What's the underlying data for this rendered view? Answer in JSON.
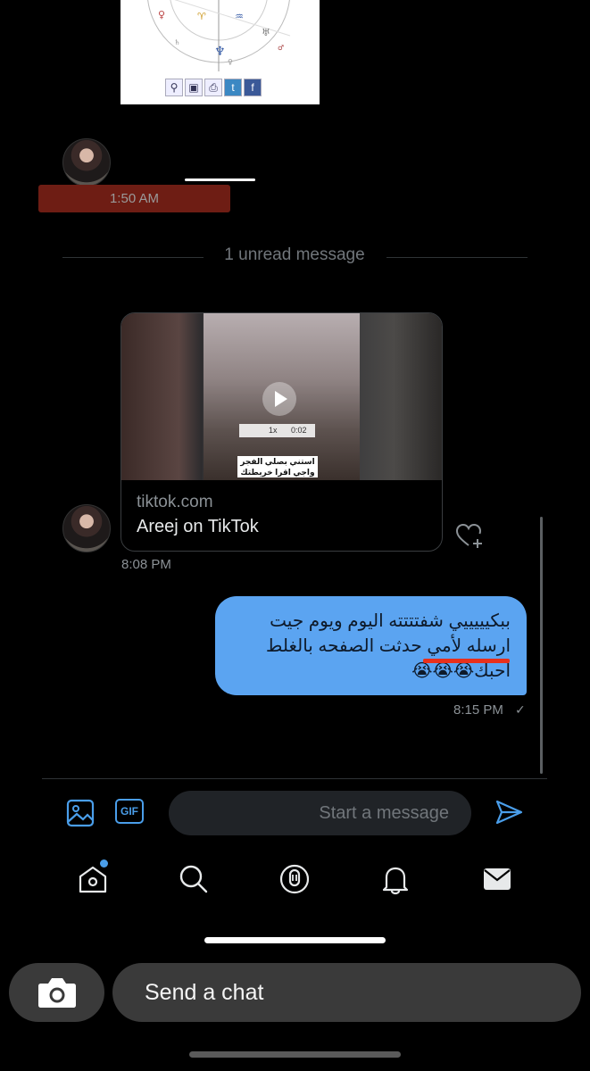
{
  "astro_card": {
    "toolbar_icons": [
      "zoom-icon",
      "save-icon",
      "print-icon",
      "twitter-icon",
      "facebook-icon"
    ]
  },
  "thread": {
    "first_time": "1:50 AM",
    "unread_divider": "1 unread message",
    "link_card": {
      "video_speed": "1x",
      "video_duration": "0:02",
      "video_caption": "استني بصلي الفجر واجي اقرا خريطتك",
      "domain": "tiktok.com",
      "title": "Areej on TikTok"
    },
    "incoming_time": "8:08 PM",
    "outgoing_message": "ببكيييييي شفتتتته اليوم ويوم جيت ارسله لأمي حدثت الصفحه بالغلط احبك😭😭😭",
    "outgoing_time": "8:15 PM",
    "read_mark": "✓"
  },
  "composer": {
    "placeholder": "Start a message",
    "gif_label": "GIF"
  },
  "tabs": [
    "home-icon",
    "search-icon",
    "spaces-icon",
    "notifications-icon",
    "messages-icon"
  ],
  "colors": {
    "accent": "#4a9eea",
    "bubble": "#5ba4f1",
    "background": "#000000"
  },
  "snap_bar": {
    "chat_label": "Send a chat"
  }
}
